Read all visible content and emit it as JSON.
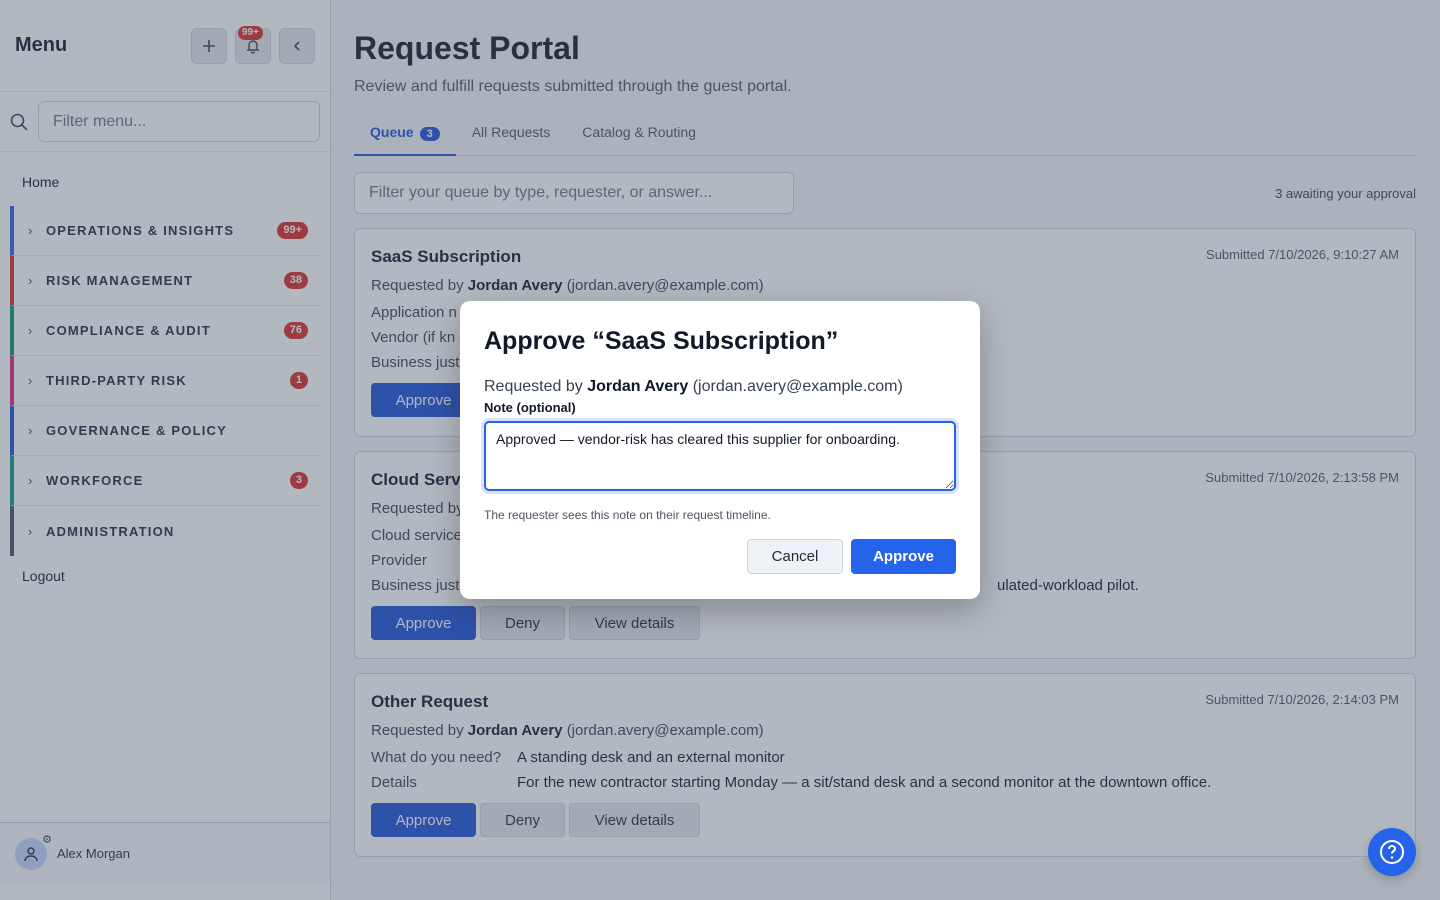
{
  "sidebar": {
    "title": "Menu",
    "add_icon": "plus-icon",
    "notif_badge": "99+",
    "filter_placeholder": "Filter menu...",
    "home": "Home",
    "groups": [
      {
        "label": "OPERATIONS & INSIGHTS",
        "badge": "99+",
        "color": "#2563eb"
      },
      {
        "label": "RISK MANAGEMENT",
        "badge": "38",
        "color": "#dc2626"
      },
      {
        "label": "COMPLIANCE & AUDIT",
        "badge": "76",
        "color": "#059669"
      },
      {
        "label": "THIRD-PARTY RISK",
        "badge": "1",
        "color": "#db2777"
      },
      {
        "label": "GOVERNANCE & POLICY",
        "badge": "",
        "color": "#1d4ed8"
      },
      {
        "label": "WORKFORCE",
        "badge": "3",
        "color": "#0d9488"
      },
      {
        "label": "ADMINISTRATION",
        "badge": "",
        "color": "#4b5563"
      }
    ],
    "logout": "Logout",
    "user_name": "Alex Morgan"
  },
  "header": {
    "title": "Request Portal",
    "subtitle": "Review and fulfill requests submitted through the guest portal."
  },
  "tabs": [
    {
      "label": "Queue",
      "count": "3"
    },
    {
      "label": "All Requests"
    },
    {
      "label": "Catalog & Routing"
    }
  ],
  "toolbar": {
    "filter_placeholder": "Filter your queue by type, requester, or answer...",
    "awaiting": "3 awaiting your approval"
  },
  "cards": [
    {
      "title": "SaaS Subscription",
      "submitted": "Submitted 7/10/2026, 9:10:27 AM",
      "requested_by_prefix": "Requested by",
      "requester_name": "Jordan Avery",
      "requester_email": "(jordan.avery@example.com)",
      "fields": [
        {
          "label": "Application n",
          "value": ""
        },
        {
          "label": "Vendor (if kn",
          "value": ""
        },
        {
          "label": "Business just",
          "value": ""
        }
      ],
      "approve": "Approve"
    },
    {
      "title": "Cloud Servi",
      "submitted": "Submitted 7/10/2026, 2:13:58 PM",
      "requested_by_prefix": "Requested by",
      "fields": [
        {
          "label": "Cloud service",
          "value": ""
        },
        {
          "label": "Provider",
          "value": ""
        },
        {
          "label": "Business just",
          "value": "ulated-workload pilot."
        }
      ],
      "approve": "Approve",
      "deny": "Deny",
      "view": "View details"
    },
    {
      "title": "Other Request",
      "submitted": "Submitted 7/10/2026, 2:14:03 PM",
      "requested_by_prefix": "Requested by",
      "requester_name": "Jordan Avery",
      "requester_email": "(jordan.avery@example.com)",
      "fields": [
        {
          "label": "What do you need?",
          "value": "A standing desk and an external monitor"
        },
        {
          "label": "Details",
          "value": "For the new contractor starting Monday — a sit/stand desk and a second monitor at the downtown office."
        }
      ],
      "approve": "Approve",
      "deny": "Deny",
      "view": "View details"
    }
  ],
  "modal": {
    "title": "Approve “SaaS Subscription”",
    "requested_by_prefix": "Requested by",
    "requester_name": "Jordan Avery",
    "requester_email": "(jordan.avery@example.com)",
    "note_label": "Note (optional)",
    "note_value": "Approved — vendor-risk has cleared this supplier for onboarding.",
    "help_text": "The requester sees this note on their request timeline.",
    "cancel": "Cancel",
    "approve": "Approve"
  },
  "colors": {
    "primary": "#2563eb",
    "badge": "#dc2626"
  }
}
